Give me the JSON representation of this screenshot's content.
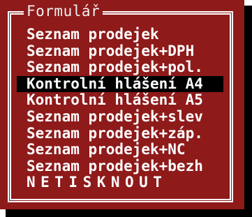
{
  "dialog": {
    "title": "Formulář"
  },
  "menu": {
    "items": [
      {
        "label": "Seznam prodejek",
        "selected": false
      },
      {
        "label": "Seznam prodejek+DPH",
        "selected": false
      },
      {
        "label": "Seznam prodejek+pol.",
        "selected": false
      },
      {
        "label": "Kontrolní hlášení A4",
        "selected": true
      },
      {
        "label": "Kontrolní hlášení A5",
        "selected": false
      },
      {
        "label": "Seznam prodejek+slev",
        "selected": false
      },
      {
        "label": "Seznam prodejek+záp.",
        "selected": false
      },
      {
        "label": "Seznam prodejek+NC",
        "selected": false
      },
      {
        "label": "Seznam prodejek+bezh",
        "selected": false
      },
      {
        "label": "NETISKNOUT",
        "selected": false
      }
    ]
  },
  "colors": {
    "window_background": "#8e1a1a",
    "text": "#ffffff",
    "selection_background": "#000000",
    "shadow": "#000000"
  }
}
